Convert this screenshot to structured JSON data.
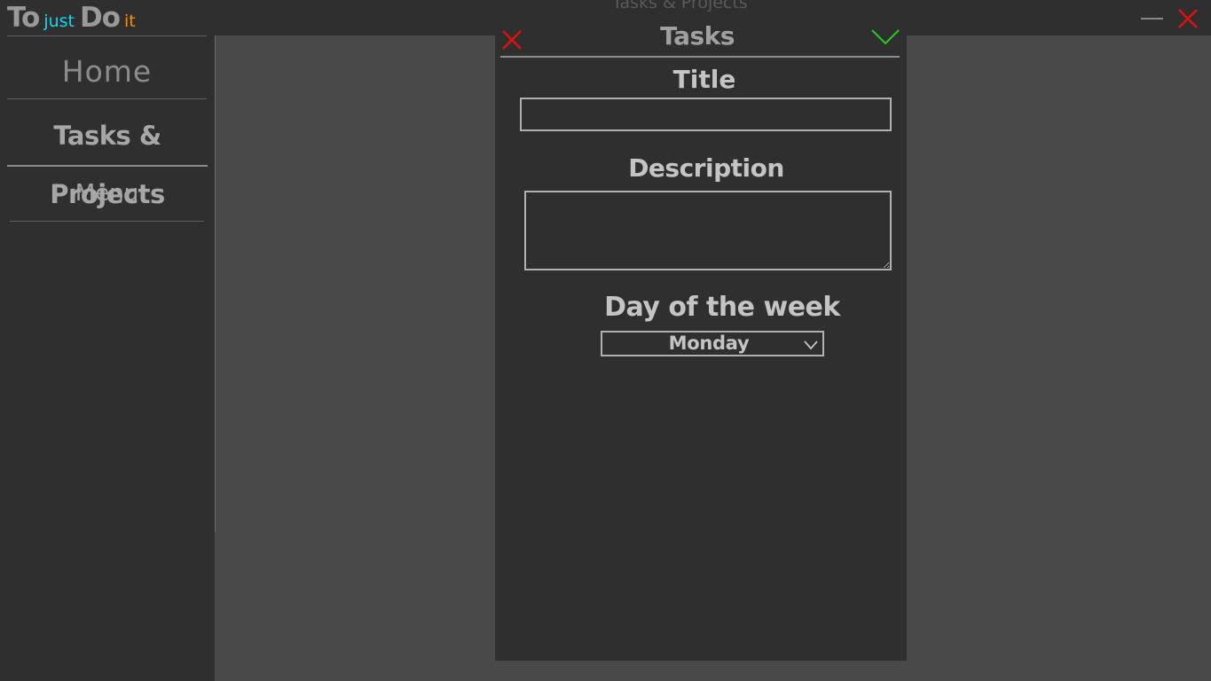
{
  "app": {
    "logo": {
      "part1": "To",
      "part2": "just",
      "part3": "Do",
      "part4": "it"
    },
    "window_title": "Tasks & Projects",
    "colors": {
      "logo_just": "#19d5ee",
      "logo_it": "#ff8c00",
      "close": "#e01010",
      "confirm": "#1fd01f"
    }
  },
  "sidebar": {
    "items": [
      {
        "label": "Home"
      },
      {
        "label": "Tasks & Projects",
        "active": true
      },
      {
        "label": "Menu"
      }
    ]
  },
  "dialog": {
    "title": "Tasks",
    "fields": {
      "title_label": "Title",
      "title_value": "",
      "description_label": "Description",
      "description_value": "",
      "day_label": "Day of the week",
      "day_value": "Monday"
    },
    "icons": {
      "cancel": "close-icon",
      "confirm": "check-icon"
    }
  }
}
